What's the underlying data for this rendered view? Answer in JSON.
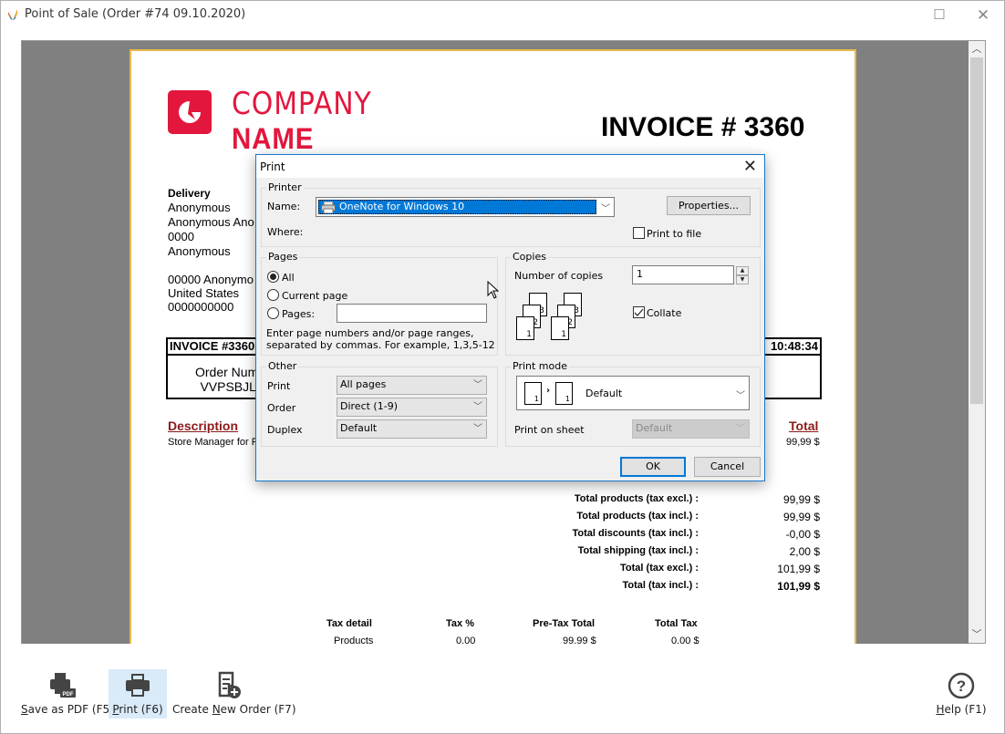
{
  "window": {
    "title": "Point of Sale (Order #74 09.10.2020)",
    "maximize_icon": "maximize-icon",
    "close_icon": "close-icon"
  },
  "invoice": {
    "company_line1": "COMPANY",
    "company_line2": "NAME",
    "title": "INVOICE # 3360",
    "delivery": {
      "heading": "Delivery",
      "lines": [
        "Anonymous",
        "Anonymous Ano",
        "0000",
        "Anonymous"
      ]
    },
    "address": [
      "00000 Anonymo",
      "United States",
      "0000000000"
    ],
    "info_header_left": "INVOICE #3360",
    "info_header_right": "10:48:34",
    "order_number_label": "Order Numl",
    "order_number_value": "VVPSBJL",
    "description_header": "Description",
    "description_value": "Store Manager for P",
    "total_header": "Total",
    "total_value": "99,99 $",
    "totals": [
      {
        "label": "Total products (tax excl.) :",
        "value": "99,99 $"
      },
      {
        "label": "Total products (tax incl.) :",
        "value": "99,99 $"
      },
      {
        "label": "Total discounts (tax incl.) :",
        "value": "-0,00 $"
      },
      {
        "label": "Total shipping (tax incl.) :",
        "value": "2,00 $"
      },
      {
        "label": "Total (tax excl.) :",
        "value": "101,99 $"
      },
      {
        "label": "Total (tax incl.) :",
        "value": "101,99 $"
      }
    ],
    "tax_table": {
      "headers": [
        "Tax detail",
        "Tax %",
        "Pre-Tax Total",
        "Total Tax"
      ],
      "rows": [
        [
          "Products",
          "0.00",
          "99.99 $",
          "0.00 $"
        ]
      ]
    },
    "brand_color": "#e3173d"
  },
  "print_dialog": {
    "title": "Print",
    "printer_group": "Printer",
    "name_label": "Name:",
    "printer_name": "OneNote for Windows 10",
    "where_label": "Where:",
    "properties_button": "Properties...",
    "print_to_file_label": "Print to file",
    "print_to_file_checked": false,
    "pages_group": "Pages",
    "radio_all": "All",
    "radio_current": "Current page",
    "radio_pages": "Pages:",
    "selected_range": "All",
    "pages_input_value": "",
    "pages_hint_line1": "Enter page numbers and/or page ranges,",
    "pages_hint_line2": "separated by commas. For example, 1,3,5-12",
    "copies_group": "Copies",
    "copies_label": "Number of copies",
    "copies_value": "1",
    "collate_label": "Collate",
    "collate_checked": true,
    "other_group": "Other",
    "print_label": "Print",
    "print_value": "All pages",
    "order_label": "Order",
    "order_value": "Direct (1-9)",
    "duplex_label": "Duplex",
    "duplex_value": "Default",
    "print_mode_group": "Print mode",
    "print_mode_value": "Default",
    "print_on_sheet_label": "Print on sheet",
    "print_on_sheet_value": "Default",
    "ok_button": "OK",
    "cancel_button": "Cancel",
    "accent_color": "#0078d7"
  },
  "toolbar": {
    "save_pdf": {
      "prefix": "",
      "accel": "S",
      "rest": "ave as PDF (F5)"
    },
    "print": {
      "accel": "P",
      "rest": "rint (F6)"
    },
    "new_order": {
      "prefix": "Create ",
      "accel": "N",
      "rest": "ew Order (F7)"
    },
    "help": {
      "accel": "H",
      "rest": "elp (F1)"
    }
  }
}
